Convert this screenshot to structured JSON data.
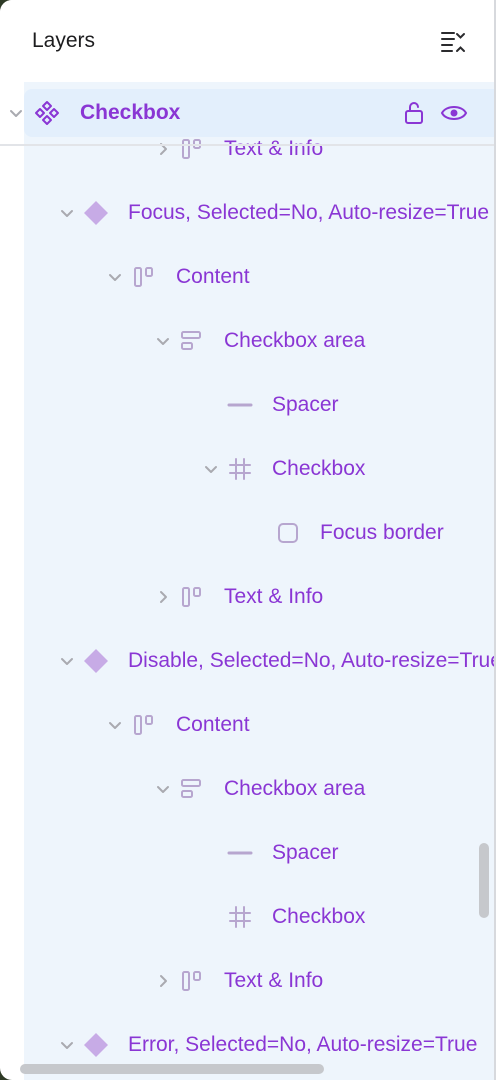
{
  "header": {
    "title": "Layers",
    "menu_icon": "list-collapse-icon"
  },
  "root": {
    "label": "Checkbox",
    "icon": "component-set-icon",
    "lock_icon": "lock-icon",
    "eye_icon": "eye-icon"
  },
  "rows": [
    {
      "label": "Text & Info",
      "icon": "auto-layout-icon",
      "caret": "right",
      "indent": 3
    },
    {
      "label": "Focus, Selected=No, Auto-resize=True",
      "icon": "variant-icon",
      "caret": "down",
      "indent": 1
    },
    {
      "label": "Content",
      "icon": "auto-layout-icon",
      "caret": "down",
      "indent": 2
    },
    {
      "label": "Checkbox area",
      "icon": "vertical-layout-icon",
      "caret": "down",
      "indent": 3
    },
    {
      "label": "Spacer",
      "icon": "line-icon",
      "caret": "none",
      "indent": 4
    },
    {
      "label": "Checkbox",
      "icon": "frame-icon",
      "caret": "down",
      "indent": 4
    },
    {
      "label": "Focus border",
      "icon": "rectangle-icon",
      "caret": "none",
      "indent": 5
    },
    {
      "label": "Text & Info",
      "icon": "auto-layout-icon",
      "caret": "right",
      "indent": 3
    },
    {
      "label": "Disable, Selected=No, Auto-resize=True",
      "icon": "variant-icon",
      "caret": "down",
      "indent": 1
    },
    {
      "label": "Content",
      "icon": "auto-layout-icon",
      "caret": "down",
      "indent": 2
    },
    {
      "label": "Checkbox area",
      "icon": "vertical-layout-icon",
      "caret": "down",
      "indent": 3
    },
    {
      "label": "Spacer",
      "icon": "line-icon",
      "caret": "none",
      "indent": 4
    },
    {
      "label": "Checkbox",
      "icon": "frame-icon",
      "caret": "none",
      "indent": 4
    },
    {
      "label": "Text & Info",
      "icon": "auto-layout-icon",
      "caret": "right",
      "indent": 3
    },
    {
      "label": "Error, Selected=No, Auto-resize=True",
      "icon": "variant-icon",
      "caret": "down",
      "indent": 1
    }
  ],
  "colors": {
    "accent": "#8a36d4",
    "icon_muted": "#b7a6cf",
    "variant_fill": "#c7abe6",
    "tree_bg": "#eef5fc",
    "selected_bg": "#e3effc"
  }
}
